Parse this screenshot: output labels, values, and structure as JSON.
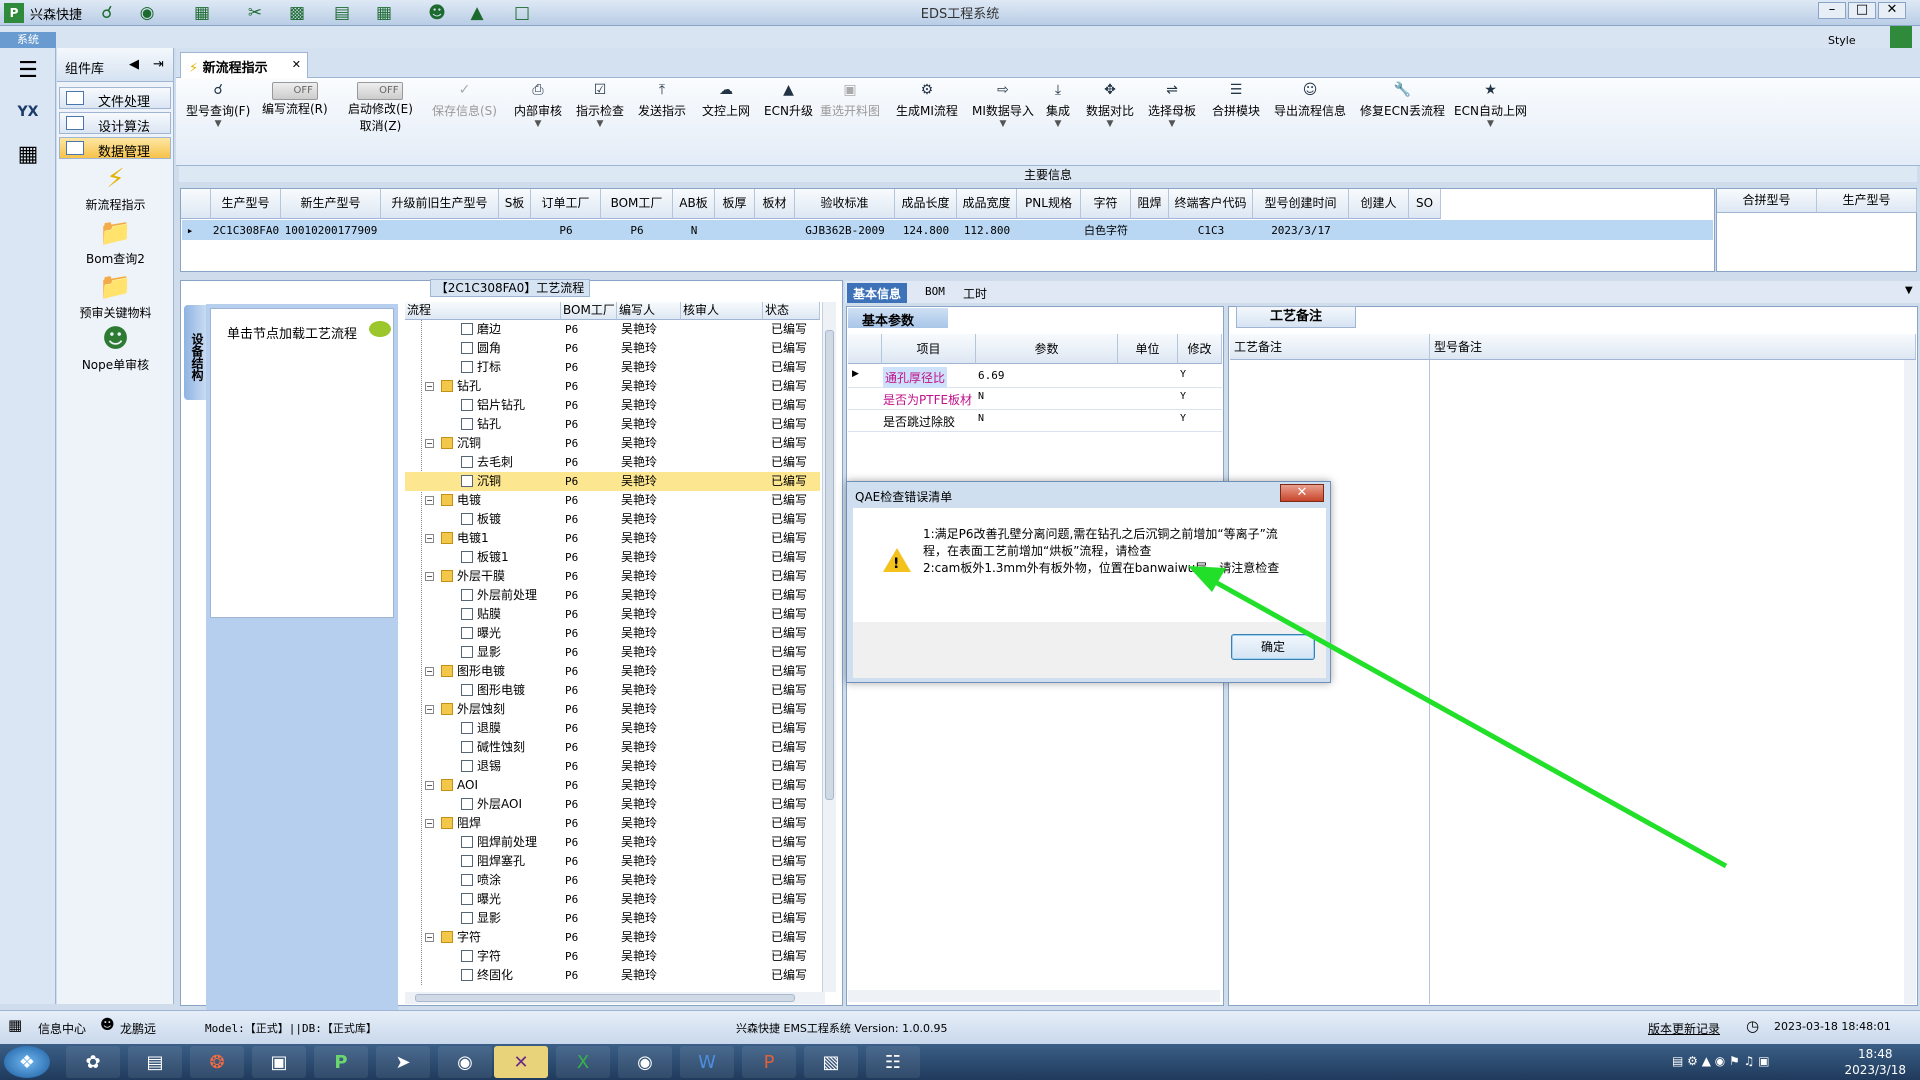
{
  "window": {
    "app_name": "兴森快捷",
    "title": "EDS工程系统",
    "sys_tag": "系统",
    "style_label": "Style"
  },
  "component_panel": {
    "header": "组件库",
    "items": [
      {
        "label": "文件处理"
      },
      {
        "label": "设计算法"
      },
      {
        "label": "数据管理"
      }
    ],
    "big_items": [
      {
        "label": "新流程指示"
      },
      {
        "label": "Bom查询2"
      },
      {
        "label": "预审关键物料"
      },
      {
        "label": "Nope单审核"
      }
    ]
  },
  "main_tab": {
    "label": "新流程指示"
  },
  "ribbon": {
    "buttons": [
      {
        "label": "型号查询(F)",
        "icon": "search-icon"
      },
      {
        "label": "编写流程(R)",
        "toggle": "OFF"
      },
      {
        "label": "启动修改(E)",
        "toggle": "OFF",
        "sub": "取消(Z)"
      },
      {
        "label": "保存信息(S)",
        "icon": "check-icon",
        "disabled": true
      },
      {
        "label": "内部审核",
        "icon": "printer-icon"
      },
      {
        "label": "指示检查",
        "icon": "checkbox-icon"
      },
      {
        "label": "发送指示",
        "icon": "upload-icon"
      },
      {
        "label": "文控上网",
        "icon": "cloud-upload-icon"
      },
      {
        "label": "ECN升级",
        "icon": "ecn-icon"
      },
      {
        "label": "重选开料图",
        "icon": "image-icon",
        "disabled": true
      },
      {
        "label": "生成MI流程",
        "icon": "gears-icon"
      },
      {
        "label": "MI数据导入",
        "icon": "import-icon"
      },
      {
        "label": "集成",
        "icon": "download-icon"
      },
      {
        "label": "数据对比",
        "icon": "compare-icon"
      },
      {
        "label": "选择母板",
        "icon": "shuffle-icon"
      },
      {
        "label": "合拼模块",
        "icon": "list-icon"
      },
      {
        "label": "导出流程信息",
        "icon": "smile-icon"
      },
      {
        "label": "修复ECN丢流程",
        "icon": "wrench-icon"
      },
      {
        "label": "ECN自动上网",
        "icon": "star-icon"
      }
    ]
  },
  "main_info": {
    "title": "主要信息",
    "columns": [
      "生产型号",
      "新生产型号",
      "升级前旧生产型号",
      "S板",
      "订单工厂",
      "BOM工厂",
      "AB板",
      "板厚",
      "板材",
      "验收标准",
      "成品长度",
      "成品宽度",
      "PNL规格",
      "字符",
      "阻焊",
      "终端客户代码",
      "型号创建时间",
      "创建人",
      "SO"
    ],
    "row": [
      "2C1C308FA0",
      "10010200177909",
      "",
      "",
      "P6",
      "P6",
      "N",
      "",
      "",
      "GJB362B-2009",
      "124.800",
      "112.800",
      "",
      "白色字符",
      "",
      "C1C3",
      "2023/3/17",
      "",
      ""
    ],
    "merge_columns": [
      "合拼型号",
      "生产型号"
    ]
  },
  "process_panel": {
    "title": "【2C1C308FA0】工艺流程",
    "vertical_tab": "设备结构",
    "hint": "单击节点加载工艺流程",
    "columns": [
      "流程",
      "BOM工厂",
      "编写人",
      "核审人",
      "状态"
    ],
    "rows": [
      {
        "name": "磨边",
        "level": 2,
        "factory": "P6",
        "writer": "吴艳玲",
        "status": "已编写"
      },
      {
        "name": "圆角",
        "level": 2,
        "factory": "P6",
        "writer": "吴艳玲",
        "status": "已编写"
      },
      {
        "name": "打标",
        "level": 2,
        "factory": "P6",
        "writer": "吴艳玲",
        "status": "已编写"
      },
      {
        "name": "钻孔",
        "level": 1,
        "factory": "P6",
        "writer": "吴艳玲",
        "status": "已编写"
      },
      {
        "name": "铝片钻孔",
        "level": 2,
        "factory": "P6",
        "writer": "吴艳玲",
        "status": "已编写"
      },
      {
        "name": "钻孔",
        "level": 2,
        "factory": "P6",
        "writer": "吴艳玲",
        "status": "已编写"
      },
      {
        "name": "沉铜",
        "level": 1,
        "factory": "P6",
        "writer": "吴艳玲",
        "status": "已编写"
      },
      {
        "name": "去毛刺",
        "level": 2,
        "factory": "P6",
        "writer": "吴艳玲",
        "status": "已编写"
      },
      {
        "name": "沉铜",
        "level": 2,
        "factory": "P6",
        "writer": "吴艳玲",
        "status": "已编写",
        "selected": true
      },
      {
        "name": "电镀",
        "level": 1,
        "factory": "P6",
        "writer": "吴艳玲",
        "status": "已编写"
      },
      {
        "name": "板镀",
        "level": 2,
        "factory": "P6",
        "writer": "吴艳玲",
        "status": "已编写"
      },
      {
        "name": "电镀1",
        "level": 1,
        "factory": "P6",
        "writer": "吴艳玲",
        "status": "已编写"
      },
      {
        "name": "板镀1",
        "level": 2,
        "factory": "P6",
        "writer": "吴艳玲",
        "status": "已编写"
      },
      {
        "name": "外层干膜",
        "level": 1,
        "factory": "P6",
        "writer": "吴艳玲",
        "status": "已编写"
      },
      {
        "name": "外层前处理",
        "level": 2,
        "factory": "P6",
        "writer": "吴艳玲",
        "status": "已编写"
      },
      {
        "name": "贴膜",
        "level": 2,
        "factory": "P6",
        "writer": "吴艳玲",
        "status": "已编写"
      },
      {
        "name": "曝光",
        "level": 2,
        "factory": "P6",
        "writer": "吴艳玲",
        "status": "已编写"
      },
      {
        "name": "显影",
        "level": 2,
        "factory": "P6",
        "writer": "吴艳玲",
        "status": "已编写"
      },
      {
        "name": "图形电镀",
        "level": 1,
        "factory": "P6",
        "writer": "吴艳玲",
        "status": "已编写"
      },
      {
        "name": "图形电镀",
        "level": 2,
        "factory": "P6",
        "writer": "吴艳玲",
        "status": "已编写"
      },
      {
        "name": "外层蚀刻",
        "level": 1,
        "factory": "P6",
        "writer": "吴艳玲",
        "status": "已编写"
      },
      {
        "name": "退膜",
        "level": 2,
        "factory": "P6",
        "writer": "吴艳玲",
        "status": "已编写"
      },
      {
        "name": "碱性蚀刻",
        "level": 2,
        "factory": "P6",
        "writer": "吴艳玲",
        "status": "已编写"
      },
      {
        "name": "退锡",
        "level": 2,
        "factory": "P6",
        "writer": "吴艳玲",
        "status": "已编写"
      },
      {
        "name": "AOI",
        "level": 1,
        "factory": "P6",
        "writer": "吴艳玲",
        "status": "已编写"
      },
      {
        "name": "外层AOI",
        "level": 2,
        "factory": "P6",
        "writer": "吴艳玲",
        "status": "已编写"
      },
      {
        "name": "阻焊",
        "level": 1,
        "factory": "P6",
        "writer": "吴艳玲",
        "status": "已编写"
      },
      {
        "name": "阻焊前处理",
        "level": 2,
        "factory": "P6",
        "writer": "吴艳玲",
        "status": "已编写"
      },
      {
        "name": "阻焊塞孔",
        "level": 2,
        "factory": "P6",
        "writer": "吴艳玲",
        "status": "已编写"
      },
      {
        "name": "喷涂",
        "level": 2,
        "factory": "P6",
        "writer": "吴艳玲",
        "status": "已编写"
      },
      {
        "name": "曝光",
        "level": 2,
        "factory": "P6",
        "writer": "吴艳玲",
        "status": "已编写"
      },
      {
        "name": "显影",
        "level": 2,
        "factory": "P6",
        "writer": "吴艳玲",
        "status": "已编写"
      },
      {
        "name": "字符",
        "level": 1,
        "factory": "P6",
        "writer": "吴艳玲",
        "status": "已编写"
      },
      {
        "name": "字符",
        "level": 2,
        "factory": "P6",
        "writer": "吴艳玲",
        "status": "已编写"
      },
      {
        "name": "终固化",
        "level": 2,
        "factory": "P6",
        "writer": "吴艳玲",
        "status": "已编写"
      }
    ]
  },
  "info_tabs": [
    "基本信息",
    "BOM",
    "工时"
  ],
  "basic_params": {
    "header": "基本参数",
    "columns": [
      "项目",
      "参数",
      "单位",
      "修改"
    ],
    "rows": [
      {
        "item": "通孔厚径比",
        "value": "6.69",
        "unit": "",
        "modify": "Y"
      },
      {
        "item": "是否为PTFE板材",
        "value": "N",
        "unit": "",
        "modify": "Y"
      },
      {
        "item": "是否跳过除胶",
        "value": "N",
        "unit": "",
        "modify": "Y"
      }
    ]
  },
  "remarks": {
    "tab": "工艺备注",
    "col1": "工艺备注",
    "col2": "型号备注"
  },
  "dialog": {
    "title": "QAE检查错误清单",
    "line1": "1:满足P6改善孔壁分离问题,需在钻孔之后沉铜之前增加“等离子”流",
    "line2": "程，在表面工艺前增加“烘板”流程，请检查",
    "line3": "2:cam板外1.3mm外有板外物，位置在banwaiwu层，请注意检查",
    "ok": "确定"
  },
  "statusbar": {
    "info_center": "信息中心",
    "user": "龙鹏远",
    "model": "Model:【正式】||DB:【正式库】",
    "version": "兴森快捷 EMS工程系统 Version: 1.0.0.95",
    "update_log": "版本更新记录",
    "datetime": "2023-03-18 18:48:01"
  },
  "taskbar": {
    "time": "18:48",
    "date": "2023/3/18"
  },
  "colors": {
    "accent": "#3d71b8",
    "selection": "#fce690",
    "arrow": "#22e02a"
  }
}
